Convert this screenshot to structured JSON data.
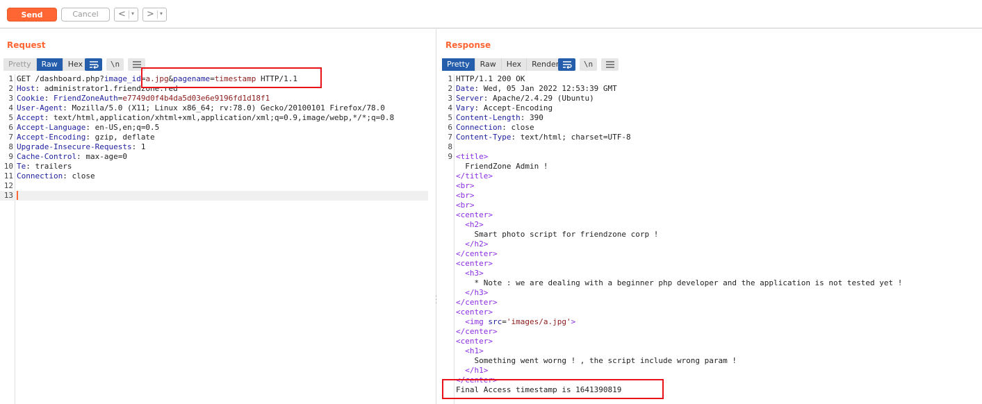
{
  "toolbar": {
    "send_label": "Send",
    "cancel_label": "Cancel",
    "prev_glyph": "<",
    "next_glyph": ">",
    "dropdown_glyph": "▾"
  },
  "request": {
    "title": "Request",
    "tabs": {
      "pretty": "Pretty",
      "raw": "Raw",
      "hex": "Hex"
    },
    "newline_label": "\\n",
    "lines": [
      {
        "n": "1",
        "parts": [
          [
            "",
            "GET /dashboard.php?"
          ],
          [
            "k",
            "image_id"
          ],
          [
            "",
            "="
          ],
          [
            "v",
            "a.jpg"
          ],
          [
            "",
            "&"
          ],
          [
            "k",
            "pagename"
          ],
          [
            "",
            "="
          ],
          [
            "v",
            "timestamp"
          ],
          [
            "",
            " HTTP/1.1"
          ]
        ]
      },
      {
        "n": "2",
        "parts": [
          [
            "k",
            "Host"
          ],
          [
            "",
            ": administrator1.friendzone.red"
          ]
        ]
      },
      {
        "n": "3",
        "parts": [
          [
            "k",
            "Cookie"
          ],
          [
            "",
            ": "
          ],
          [
            "k",
            "FriendZoneAuth"
          ],
          [
            "",
            "="
          ],
          [
            "v",
            "e7749d0f4b4da5d03e6e9196fd1d18f1"
          ]
        ]
      },
      {
        "n": "4",
        "parts": [
          [
            "k",
            "User-Agent"
          ],
          [
            "",
            ": Mozilla/5.0 (X11; Linux x86_64; rv:78.0) Gecko/20100101 Firefox/78.0"
          ]
        ]
      },
      {
        "n": "5",
        "parts": [
          [
            "k",
            "Accept"
          ],
          [
            "",
            ": text/html,application/xhtml+xml,application/xml;q=0.9,image/webp,*/*;q=0.8"
          ]
        ]
      },
      {
        "n": "6",
        "parts": [
          [
            "k",
            "Accept-Language"
          ],
          [
            "",
            ": en-US,en;q=0.5"
          ]
        ]
      },
      {
        "n": "7",
        "parts": [
          [
            "k",
            "Accept-Encoding"
          ],
          [
            "",
            ": gzip, deflate"
          ]
        ]
      },
      {
        "n": "8",
        "parts": [
          [
            "k",
            "Upgrade-Insecure-Requests"
          ],
          [
            "",
            ": 1"
          ]
        ]
      },
      {
        "n": "9",
        "parts": [
          [
            "k",
            "Cache-Control"
          ],
          [
            "",
            ": max-age=0"
          ]
        ]
      },
      {
        "n": "10",
        "parts": [
          [
            "k",
            "Te"
          ],
          [
            "",
            ": trailers"
          ]
        ]
      },
      {
        "n": "11",
        "parts": [
          [
            "k",
            "Connection"
          ],
          [
            "",
            ": close"
          ]
        ]
      },
      {
        "n": "12",
        "parts": []
      },
      {
        "n": "13",
        "parts": [],
        "caret": true
      }
    ]
  },
  "response": {
    "title": "Response",
    "tabs": {
      "pretty": "Pretty",
      "raw": "Raw",
      "hex": "Hex",
      "render": "Render"
    },
    "newline_label": "\\n",
    "lines": [
      {
        "n": "1",
        "parts": [
          [
            "",
            "HTTP/1.1 200 OK"
          ]
        ]
      },
      {
        "n": "2",
        "parts": [
          [
            "k",
            "Date"
          ],
          [
            "",
            ": Wed, 05 Jan 2022 12:53:39 GMT"
          ]
        ]
      },
      {
        "n": "3",
        "parts": [
          [
            "k",
            "Server"
          ],
          [
            "",
            ": Apache/2.4.29 (Ubuntu)"
          ]
        ]
      },
      {
        "n": "4",
        "parts": [
          [
            "k",
            "Vary"
          ],
          [
            "",
            ": Accept-Encoding"
          ]
        ]
      },
      {
        "n": "5",
        "parts": [
          [
            "k",
            "Content-Length"
          ],
          [
            "",
            ": 390"
          ]
        ]
      },
      {
        "n": "6",
        "parts": [
          [
            "k",
            "Connection"
          ],
          [
            "",
            ": close"
          ]
        ]
      },
      {
        "n": "7",
        "parts": [
          [
            "k",
            "Content-Type"
          ],
          [
            "",
            ": text/html; charset=UTF-8"
          ]
        ]
      },
      {
        "n": "8",
        "parts": []
      },
      {
        "n": "9",
        "parts": [
          [
            "tag",
            "<title>"
          ]
        ]
      },
      {
        "n": "",
        "parts": [
          [
            "",
            "  FriendZone Admin !"
          ]
        ]
      },
      {
        "n": "",
        "parts": [
          [
            "tag",
            "</title>"
          ]
        ]
      },
      {
        "n": "",
        "parts": [
          [
            "tag",
            "<br>"
          ]
        ]
      },
      {
        "n": "",
        "parts": [
          [
            "tag",
            "<br>"
          ]
        ]
      },
      {
        "n": "",
        "parts": [
          [
            "tag",
            "<br>"
          ]
        ]
      },
      {
        "n": "",
        "parts": [
          [
            "tag",
            "<center>"
          ]
        ]
      },
      {
        "n": "",
        "parts": [
          [
            "tag",
            "  <h2>"
          ]
        ]
      },
      {
        "n": "",
        "parts": [
          [
            "",
            "    Smart photo script for friendzone corp !"
          ]
        ]
      },
      {
        "n": "",
        "parts": [
          [
            "tag",
            "  </h2>"
          ]
        ]
      },
      {
        "n": "",
        "parts": [
          [
            "tag",
            "</center>"
          ]
        ]
      },
      {
        "n": "",
        "parts": [
          [
            "tag",
            "<center>"
          ]
        ]
      },
      {
        "n": "",
        "parts": [
          [
            "tag",
            "  <h3>"
          ]
        ]
      },
      {
        "n": "",
        "parts": [
          [
            "",
            "    * Note : we are dealing with a beginner php developer and the application is not tested yet !"
          ]
        ]
      },
      {
        "n": "",
        "parts": [
          [
            "tag",
            "  </h3>"
          ]
        ]
      },
      {
        "n": "",
        "parts": [
          [
            "tag",
            "</center>"
          ]
        ]
      },
      {
        "n": "",
        "parts": [
          [
            "tag",
            "<center>"
          ]
        ]
      },
      {
        "n": "",
        "parts": [
          [
            "tag",
            "  <img "
          ],
          [
            "attr",
            "src"
          ],
          [
            "",
            "="
          ],
          [
            "str",
            "'images/a.jpg'"
          ],
          [
            "tag",
            ">"
          ]
        ]
      },
      {
        "n": "",
        "parts": [
          [
            "tag",
            "</center>"
          ]
        ]
      },
      {
        "n": "",
        "parts": [
          [
            "tag",
            "<center>"
          ]
        ]
      },
      {
        "n": "",
        "parts": [
          [
            "tag",
            "  <h1>"
          ]
        ]
      },
      {
        "n": "",
        "parts": [
          [
            "",
            "    Something went worng ! , the script include wrong param !"
          ]
        ]
      },
      {
        "n": "",
        "parts": [
          [
            "tag",
            "  </h1>"
          ]
        ]
      },
      {
        "n": "",
        "parts": [
          [
            "tag",
            "</center>"
          ]
        ]
      },
      {
        "n": "",
        "parts": [
          [
            "",
            "Final Access timestamp is 1641390819"
          ]
        ]
      }
    ]
  },
  "colors": {
    "accent": "#ff6633",
    "active_tab": "#235dab",
    "highlight_box": "#e8121a"
  }
}
